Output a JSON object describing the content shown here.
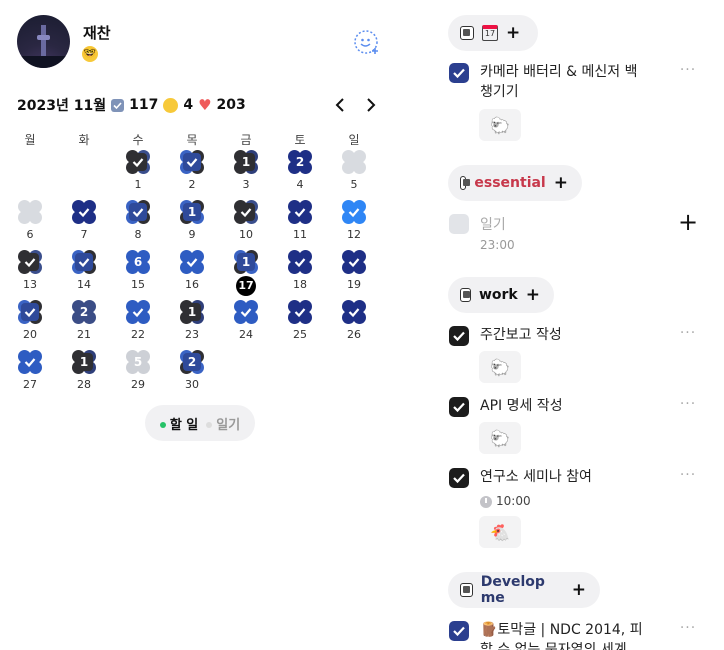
{
  "profile": {
    "name": "재찬",
    "status_emoji": "🤓"
  },
  "header": {
    "month_title": "2023년 11월",
    "done_count": "117",
    "emoji_count": "4",
    "like_count": "203"
  },
  "weekdays": [
    "월",
    "화",
    "수",
    "목",
    "금",
    "토",
    "일"
  ],
  "calendar_days": [
    {
      "d": "1",
      "badge": "",
      "style": "check-dark"
    },
    {
      "d": "2",
      "badge": "",
      "style": "check-mix"
    },
    {
      "d": "3",
      "badge": "1",
      "style": "num-dark"
    },
    {
      "d": "4",
      "badge": "2",
      "style": "num-navy"
    },
    {
      "d": "5",
      "badge": "",
      "style": "empty"
    },
    {
      "d": "6",
      "badge": "",
      "style": "empty"
    },
    {
      "d": "7",
      "badge": "",
      "style": "check-navy"
    },
    {
      "d": "8",
      "badge": "",
      "style": "check-mix"
    },
    {
      "d": "9",
      "badge": "1",
      "style": "num-mix"
    },
    {
      "d": "10",
      "badge": "",
      "style": "check-dark"
    },
    {
      "d": "11",
      "badge": "",
      "style": "check-navy"
    },
    {
      "d": "12",
      "badge": "",
      "style": "check-bright"
    },
    {
      "d": "13",
      "badge": "",
      "style": "check-dark"
    },
    {
      "d": "14",
      "badge": "",
      "style": "check-mix"
    },
    {
      "d": "15",
      "badge": "6",
      "style": "num-blue"
    },
    {
      "d": "16",
      "badge": "",
      "style": "check-blue"
    },
    {
      "d": "17",
      "badge": "1",
      "style": "num-mix",
      "today": true
    },
    {
      "d": "18",
      "badge": "",
      "style": "check-navy"
    },
    {
      "d": "19",
      "badge": "",
      "style": "check-navy"
    },
    {
      "d": "20",
      "badge": "",
      "style": "check-mix"
    },
    {
      "d": "21",
      "badge": "2",
      "style": "num-slate"
    },
    {
      "d": "22",
      "badge": "",
      "style": "check-blue"
    },
    {
      "d": "23",
      "badge": "1",
      "style": "num-dark"
    },
    {
      "d": "24",
      "badge": "",
      "style": "check-blue"
    },
    {
      "d": "25",
      "badge": "",
      "style": "check-navy"
    },
    {
      "d": "26",
      "badge": "",
      "style": "check-navy"
    },
    {
      "d": "27",
      "badge": "",
      "style": "check-blue"
    },
    {
      "d": "28",
      "badge": "1",
      "style": "num-dark"
    },
    {
      "d": "29",
      "badge": "5",
      "style": "num-light"
    },
    {
      "d": "30",
      "badge": "2",
      "style": "num-mix"
    }
  ],
  "toggle": {
    "todo_label": "할 일",
    "diary_label": "일기"
  },
  "groups": {
    "g1": {
      "task1": "카메라 배터리 & 메신저 백",
      "task1_line2": "챙기기"
    },
    "essential": {
      "label": "essential",
      "color": "#c7384b",
      "item": "일기",
      "time": "23:00"
    },
    "work": {
      "label": "work",
      "task1": "주간보고 작성",
      "task2": "API 명세 작성",
      "task3": "연구소 세미나 참여",
      "task3_time": "10:00"
    },
    "develop": {
      "label": "Develop me",
      "color": "#2d3a6e",
      "task1": "🪵토막글 | NDC 2014, 피",
      "task1_line2": "할 수 없는 문자열의 세계"
    }
  },
  "icons": [
    "person-add-icon",
    "chevron-left-icon",
    "chevron-right-icon",
    "calendar-icon",
    "plus-icon",
    "more-icon",
    "clock-icon",
    "check-icon"
  ]
}
